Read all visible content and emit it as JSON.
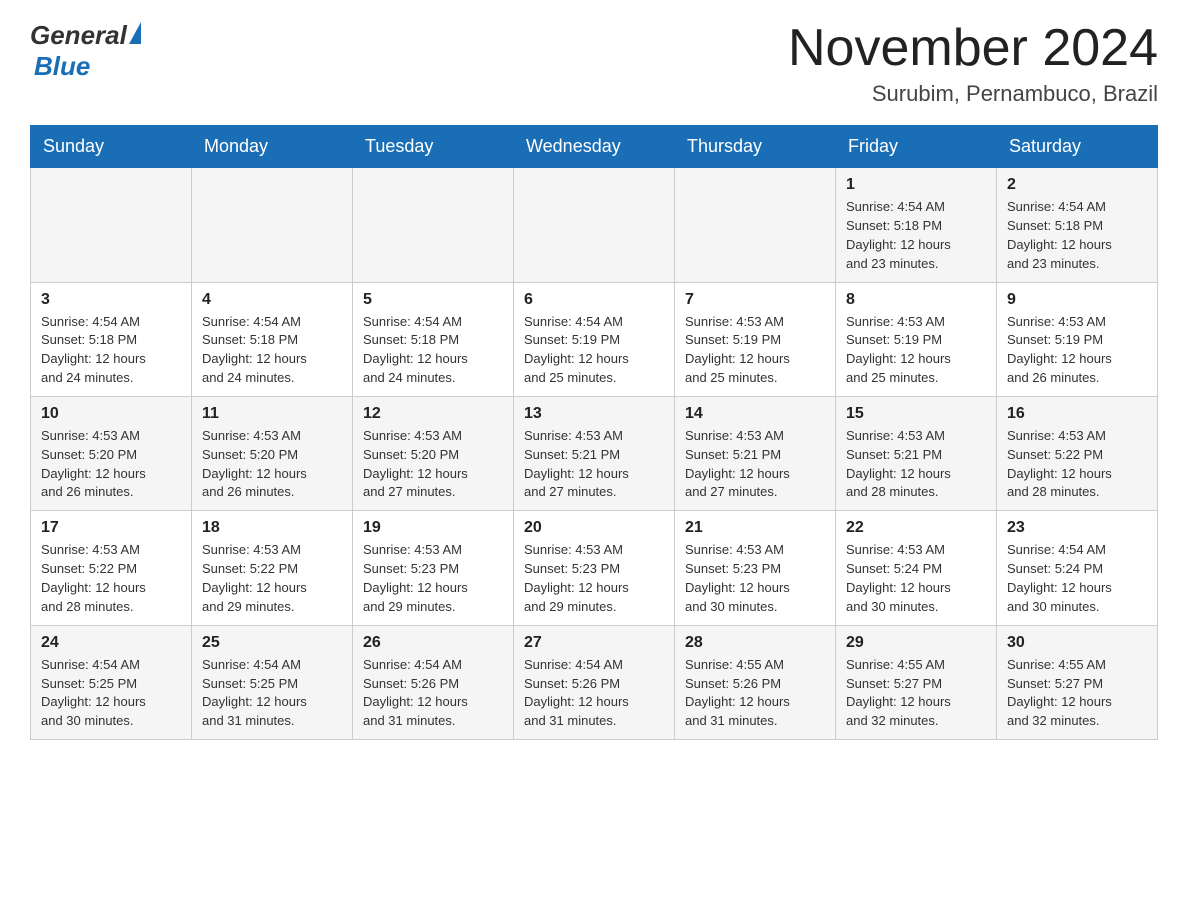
{
  "header": {
    "logo_general": "General",
    "logo_blue": "Blue",
    "month_title": "November 2024",
    "location": "Surubim, Pernambuco, Brazil"
  },
  "days_of_week": [
    "Sunday",
    "Monday",
    "Tuesday",
    "Wednesday",
    "Thursday",
    "Friday",
    "Saturday"
  ],
  "weeks": [
    [
      {
        "day": "",
        "info": ""
      },
      {
        "day": "",
        "info": ""
      },
      {
        "day": "",
        "info": ""
      },
      {
        "day": "",
        "info": ""
      },
      {
        "day": "",
        "info": ""
      },
      {
        "day": "1",
        "info": "Sunrise: 4:54 AM\nSunset: 5:18 PM\nDaylight: 12 hours\nand 23 minutes."
      },
      {
        "day": "2",
        "info": "Sunrise: 4:54 AM\nSunset: 5:18 PM\nDaylight: 12 hours\nand 23 minutes."
      }
    ],
    [
      {
        "day": "3",
        "info": "Sunrise: 4:54 AM\nSunset: 5:18 PM\nDaylight: 12 hours\nand 24 minutes."
      },
      {
        "day": "4",
        "info": "Sunrise: 4:54 AM\nSunset: 5:18 PM\nDaylight: 12 hours\nand 24 minutes."
      },
      {
        "day": "5",
        "info": "Sunrise: 4:54 AM\nSunset: 5:18 PM\nDaylight: 12 hours\nand 24 minutes."
      },
      {
        "day": "6",
        "info": "Sunrise: 4:54 AM\nSunset: 5:19 PM\nDaylight: 12 hours\nand 25 minutes."
      },
      {
        "day": "7",
        "info": "Sunrise: 4:53 AM\nSunset: 5:19 PM\nDaylight: 12 hours\nand 25 minutes."
      },
      {
        "day": "8",
        "info": "Sunrise: 4:53 AM\nSunset: 5:19 PM\nDaylight: 12 hours\nand 25 minutes."
      },
      {
        "day": "9",
        "info": "Sunrise: 4:53 AM\nSunset: 5:19 PM\nDaylight: 12 hours\nand 26 minutes."
      }
    ],
    [
      {
        "day": "10",
        "info": "Sunrise: 4:53 AM\nSunset: 5:20 PM\nDaylight: 12 hours\nand 26 minutes."
      },
      {
        "day": "11",
        "info": "Sunrise: 4:53 AM\nSunset: 5:20 PM\nDaylight: 12 hours\nand 26 minutes."
      },
      {
        "day": "12",
        "info": "Sunrise: 4:53 AM\nSunset: 5:20 PM\nDaylight: 12 hours\nand 27 minutes."
      },
      {
        "day": "13",
        "info": "Sunrise: 4:53 AM\nSunset: 5:21 PM\nDaylight: 12 hours\nand 27 minutes."
      },
      {
        "day": "14",
        "info": "Sunrise: 4:53 AM\nSunset: 5:21 PM\nDaylight: 12 hours\nand 27 minutes."
      },
      {
        "day": "15",
        "info": "Sunrise: 4:53 AM\nSunset: 5:21 PM\nDaylight: 12 hours\nand 28 minutes."
      },
      {
        "day": "16",
        "info": "Sunrise: 4:53 AM\nSunset: 5:22 PM\nDaylight: 12 hours\nand 28 minutes."
      }
    ],
    [
      {
        "day": "17",
        "info": "Sunrise: 4:53 AM\nSunset: 5:22 PM\nDaylight: 12 hours\nand 28 minutes."
      },
      {
        "day": "18",
        "info": "Sunrise: 4:53 AM\nSunset: 5:22 PM\nDaylight: 12 hours\nand 29 minutes."
      },
      {
        "day": "19",
        "info": "Sunrise: 4:53 AM\nSunset: 5:23 PM\nDaylight: 12 hours\nand 29 minutes."
      },
      {
        "day": "20",
        "info": "Sunrise: 4:53 AM\nSunset: 5:23 PM\nDaylight: 12 hours\nand 29 minutes."
      },
      {
        "day": "21",
        "info": "Sunrise: 4:53 AM\nSunset: 5:23 PM\nDaylight: 12 hours\nand 30 minutes."
      },
      {
        "day": "22",
        "info": "Sunrise: 4:53 AM\nSunset: 5:24 PM\nDaylight: 12 hours\nand 30 minutes."
      },
      {
        "day": "23",
        "info": "Sunrise: 4:54 AM\nSunset: 5:24 PM\nDaylight: 12 hours\nand 30 minutes."
      }
    ],
    [
      {
        "day": "24",
        "info": "Sunrise: 4:54 AM\nSunset: 5:25 PM\nDaylight: 12 hours\nand 30 minutes."
      },
      {
        "day": "25",
        "info": "Sunrise: 4:54 AM\nSunset: 5:25 PM\nDaylight: 12 hours\nand 31 minutes."
      },
      {
        "day": "26",
        "info": "Sunrise: 4:54 AM\nSunset: 5:26 PM\nDaylight: 12 hours\nand 31 minutes."
      },
      {
        "day": "27",
        "info": "Sunrise: 4:54 AM\nSunset: 5:26 PM\nDaylight: 12 hours\nand 31 minutes."
      },
      {
        "day": "28",
        "info": "Sunrise: 4:55 AM\nSunset: 5:26 PM\nDaylight: 12 hours\nand 31 minutes."
      },
      {
        "day": "29",
        "info": "Sunrise: 4:55 AM\nSunset: 5:27 PM\nDaylight: 12 hours\nand 32 minutes."
      },
      {
        "day": "30",
        "info": "Sunrise: 4:55 AM\nSunset: 5:27 PM\nDaylight: 12 hours\nand 32 minutes."
      }
    ]
  ]
}
